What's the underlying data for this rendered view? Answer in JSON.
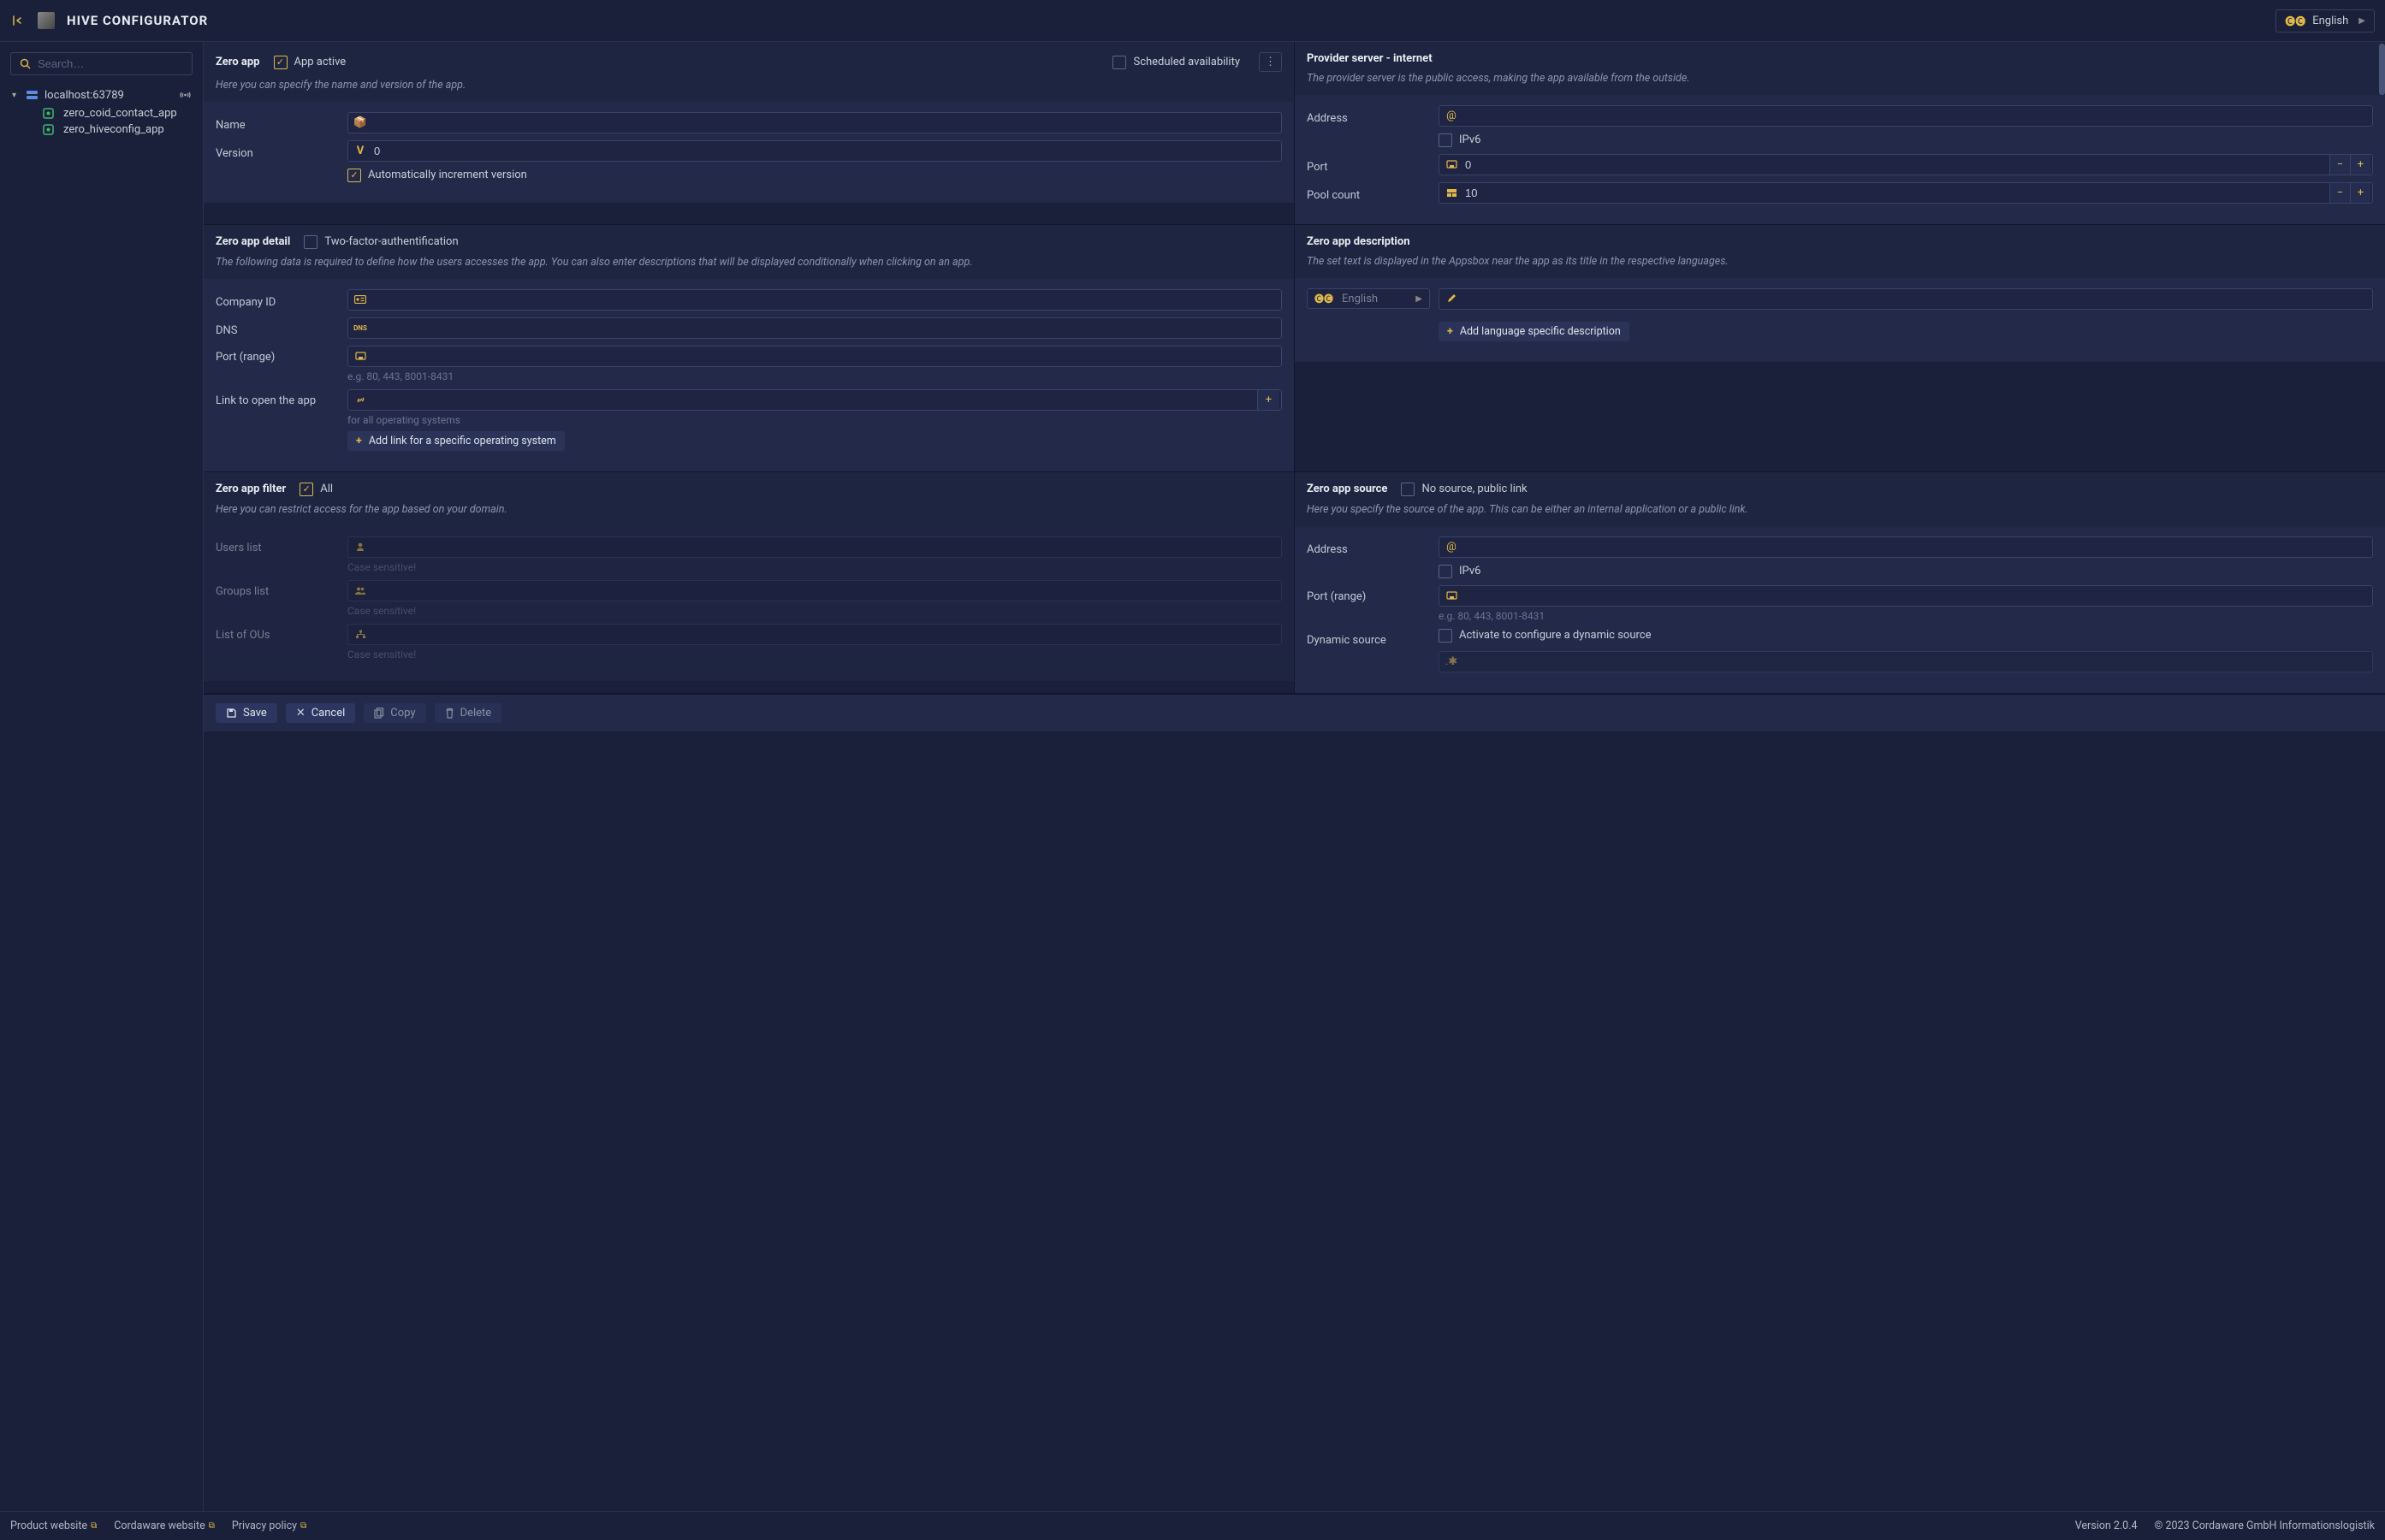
{
  "topbar": {
    "title": "HIVE CONFIGURATOR",
    "language": "English"
  },
  "sidebar": {
    "search_placeholder": "Search…",
    "root": "localhost:63789",
    "items": [
      "zero_coid_contact_app",
      "zero_hiveconfig_app"
    ]
  },
  "sections": {
    "zero_app": {
      "title": "Zero app",
      "desc": "Here you can specify the name and version of the app.",
      "app_active_label": "App active",
      "app_active": true,
      "scheduled_label": "Scheduled availability",
      "scheduled": false,
      "fields": {
        "name_label": "Name",
        "name_value": "",
        "version_label": "Version",
        "version_value": "0",
        "auto_inc_label": "Automatically increment version",
        "auto_inc": true
      }
    },
    "provider": {
      "title": "Provider server - internet",
      "desc": "The provider server is the public access, making the app available from the outside.",
      "address_label": "Address",
      "address_value": "",
      "ipv6_label": "IPv6",
      "ipv6": false,
      "port_label": "Port",
      "port_value": "0",
      "pool_label": "Pool count",
      "pool_value": "10"
    },
    "detail": {
      "title": "Zero app detail",
      "tfa_label": "Two-factor-authentification",
      "tfa": false,
      "desc": "The following data is required to define how the users accesses the app. You can also enter descriptions that will be displayed conditionally when clicking on an app.",
      "company_label": "Company ID",
      "dns_label": "DNS",
      "port_range_label": "Port (range)",
      "port_hint": "e.g. 80, 443, 8001-8431",
      "link_label": "Link to open the app",
      "link_hint": "for all operating systems",
      "add_os_link": "Add link for a specific operating system"
    },
    "description": {
      "title": "Zero app description",
      "desc": "The set text is displayed in the Appsbox near the app as its title in the respective languages.",
      "lang": "English",
      "add_lang": "Add language specific description"
    },
    "filter": {
      "title": "Zero app filter",
      "all_label": "All",
      "all": true,
      "desc": "Here you can restrict access for the app based on your domain.",
      "users_label": "Users list",
      "groups_label": "Groups list",
      "ous_label": "List of OUs",
      "case_hint": "Case sensitive!"
    },
    "source": {
      "title": "Zero app source",
      "nolink_label": "No source, public link",
      "nolink": false,
      "desc": "Here you specify the source of the app. This can be either an internal application or a public link.",
      "address_label": "Address",
      "ipv6_label": "IPv6",
      "port_range_label": "Port (range)",
      "port_hint": "e.g. 80, 443, 8001-8431",
      "dynamic_label": "Dynamic source",
      "dynamic_chk_label": "Activate to configure a dynamic source",
      "dynamic": false
    }
  },
  "actions": {
    "save": "Save",
    "cancel": "Cancel",
    "copy": "Copy",
    "delete": "Delete"
  },
  "footer": {
    "product": "Product website",
    "cordaware": "Cordaware website",
    "privacy": "Privacy policy",
    "version": "Version 2.0.4",
    "copyright": "© 2023 Cordaware GmbH Informationslogistik"
  }
}
